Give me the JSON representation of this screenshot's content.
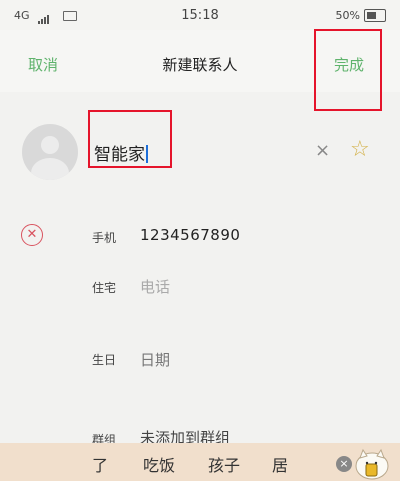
{
  "status_bar": {
    "network": "4G",
    "time": "15:18",
    "battery": "50%"
  },
  "nav": {
    "cancel": "取消",
    "title": "新建联系人",
    "done": "完成"
  },
  "contact": {
    "name": "智能家"
  },
  "fields": {
    "phone": {
      "label": "手机",
      "value": "1234567890"
    },
    "home": {
      "label": "住宅",
      "placeholder": "电话"
    },
    "birthday": {
      "label": "生日",
      "placeholder": "日期"
    },
    "group": {
      "label": "群组",
      "value": "未添加到群组"
    }
  },
  "ime": {
    "candidates": [
      "了",
      "吃饭",
      "孩子",
      "居"
    ]
  },
  "colors": {
    "accent": "#5fb36c",
    "highlight": "#e5142b",
    "remove": "#d9535f"
  }
}
